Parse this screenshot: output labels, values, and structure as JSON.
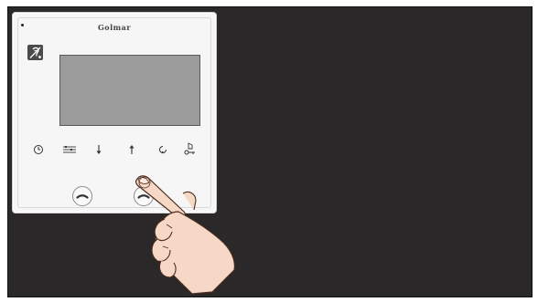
{
  "device": {
    "brand": "Golmar"
  },
  "controls": {
    "icons": [
      "clock-icon",
      "menu-list-icon",
      "arrow-down-icon",
      "arrow-up-icon",
      "rotate-icon",
      "door-key-icon"
    ]
  },
  "colors": {
    "background": "#2a2829",
    "monitor": "#f6f6f6",
    "screen": "#9b9b9b",
    "skin": "#f7d8c6"
  }
}
